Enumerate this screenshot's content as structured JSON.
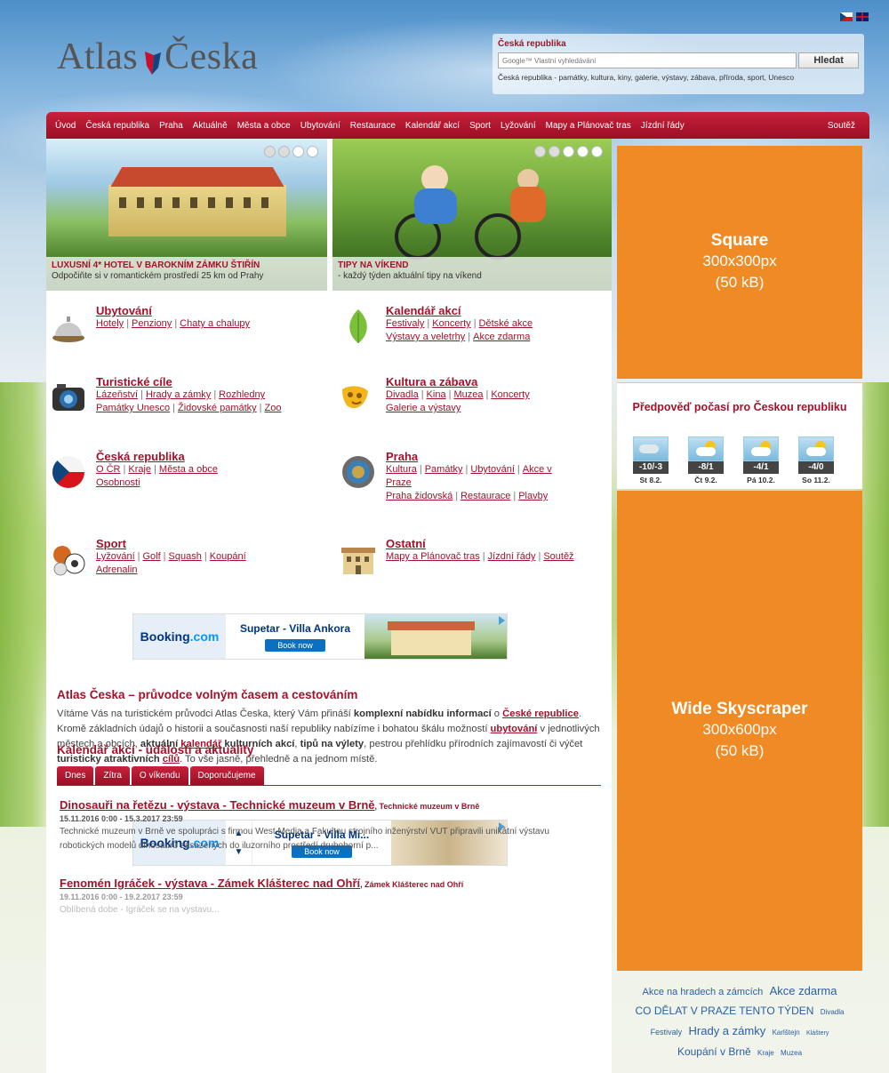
{
  "logo": {
    "text_left": "Atlas",
    "text_right": "Česka"
  },
  "search": {
    "title": "Česká republika",
    "placeholder": "Google™ Vlastní vyhledávání",
    "button": "Hledat",
    "description": "Česká republika - památky, kultura, kiny, galerie, výstavy, zábava, příroda, sport, Unesco"
  },
  "menu": {
    "items": [
      "Úvod",
      "Česká republika",
      "Praha",
      "Aktuálně",
      "Města a obce",
      "Ubytování",
      "Restaurace",
      "Kalendář akcí",
      "Sport",
      "Lyžování",
      "Mapy a Plánovač tras",
      "Jízdní řády"
    ],
    "contest": "Soutěž"
  },
  "slides": [
    {
      "title": "Luxusní 4* hotel v barokním zámku Štiřín",
      "subtitle": "Odpočiňte si v romantickém prostředí 25 km od Prahy"
    },
    {
      "title": "Tipy na víkend",
      "subtitle": "- každý týden aktuální tipy na víkend"
    }
  ],
  "categories": [
    {
      "title": "Ubytování",
      "lines": [
        [
          "Hotely",
          "Penziony",
          "Chaty a chalupy"
        ]
      ]
    },
    {
      "title": "Kalendář akcí",
      "lines": [
        [
          "Festivaly",
          "Koncerty",
          "Dětské akce"
        ],
        [
          "Výstavy a veletrhy",
          "Akce zdarma"
        ]
      ]
    },
    {
      "title": "Turistické cíle",
      "lines": [
        [
          "Lázeňství",
          "Hrady a zámky",
          "Rozhledny"
        ],
        [
          "Památky Unesco",
          "Židovské památky",
          "Zoo"
        ]
      ]
    },
    {
      "title": "Kultura a zábava",
      "lines": [
        [
          "Divadla",
          "Kina",
          "Muzea",
          "Koncerty"
        ],
        [
          "Galerie a výstavy"
        ]
      ]
    },
    {
      "title": "Česká republika",
      "lines": [
        [
          "O ČR",
          "Kraje",
          "Města a obce"
        ],
        [
          "Osobnosti"
        ]
      ]
    },
    {
      "title": "Praha",
      "lines": [
        [
          "Kultura",
          "Památky",
          "Ubytování",
          "Akce v"
        ],
        [
          "Praze"
        ],
        [
          "Praha židovská",
          "Restaurace",
          "Plavby"
        ]
      ]
    },
    {
      "title": "Sport",
      "lines": [
        [
          "Lyžování",
          "Golf",
          "Squash",
          "Koupání"
        ],
        [
          "Adrenalin"
        ]
      ]
    },
    {
      "title": "Ostatní",
      "lines": [
        [
          "Mapy a Plánovač tras",
          "Jízdní řády",
          "Soutěž"
        ]
      ]
    }
  ],
  "booking_ads": [
    {
      "logo_a": "Booking",
      "logo_b": ".com",
      "name": "Supetar - Villa Ankora",
      "button": "Book now"
    },
    {
      "logo_a": "Booking",
      "logo_b": ".com",
      "name": "Supetar - Villa Mi...",
      "button": "Book now",
      "up": "▲",
      "down": "▼"
    }
  ],
  "intro": {
    "title": "Atlas Česka – průvodce volným časem a cestováním",
    "p1": "Vítáme Vás na turistickém průvodci Atlas Česka, který Vám přináší ",
    "b1": "komplexní nabídku informací",
    "p2": " o ",
    "a1": "České republice",
    "p3": ". Kromě základních údajů o historii a současnosti naší republiky nabízíme i bohatou škálu možností ",
    "a2": "ubytování",
    "p4": " v jednotlivých městech a obcích, ",
    "b2": "aktuální",
    "a3": "kalendář",
    "b3": " kulturních akcí",
    "p5": ", ",
    "b4": "tipů na výlety",
    "p6": ", pestrou přehlídku přírodních zajímavostí či výčet ",
    "b5": "turisticky atraktivních",
    "a4": "cílů",
    "p7": ". To vše jasně, přehledně a na jednom místě."
  },
  "calendar": {
    "title": "Kalendář akcí - události a aktuality",
    "tabs": [
      "Dnes",
      "Zítra",
      "O víkendu",
      "Doporučujeme"
    ],
    "events": [
      {
        "title": "Dinosauři na řetězu - výstava - Technické muzeum v Brně",
        "venue": "Technické muzeum v Brně",
        "date": "15.11.2016 0:00 - 15.3.2017 23:59",
        "desc": "Technické muzeum v Brně ve spolupráci s firmou West Media a Fakultou strojního inženýrství VUT připravili unikátní výstavu robotických modelů dinosaurů zasazených do iluzorního prostředí druhohorní p..."
      },
      {
        "title": "Fenomén Igráček - výstava - Zámek Klášterec nad Ohří",
        "venue": "Zámek Klášterec nad Ohří",
        "date": "19.11.2016 0:00 - 19.2.2017 23:59",
        "desc": "Oblíbená dobe - Igráček se na vystavu..."
      }
    ]
  },
  "ads": {
    "square": {
      "name": "Square",
      "size": "300x300px",
      "weight": "(50 kB)"
    },
    "sky": {
      "name": "Wide Skyscraper",
      "size": "300x600px",
      "weight": "(50 kB)"
    }
  },
  "weather": {
    "title": "Předpověď počasí pro Českou republiku",
    "days": [
      {
        "temp": "-10/-3",
        "date": "St 8.2."
      },
      {
        "temp": "-8/1",
        "date": "Čt 9.2."
      },
      {
        "temp": "-4/1",
        "date": "Pá 10.2."
      },
      {
        "temp": "-4/0",
        "date": "So 11.2."
      }
    ]
  },
  "tags": [
    {
      "text": "Akce na hradech a zámcích",
      "size": 11
    },
    {
      "text": "Akce zdarma",
      "size": 13
    },
    {
      "text": "CO DĚLAT V PRAZE TENTO TÝDEN",
      "size": 12
    },
    {
      "text": "Divadla",
      "size": 8
    },
    {
      "text": "Festivaly",
      "size": 9
    },
    {
      "text": "Hrady a zámky",
      "size": 13
    },
    {
      "text": "Karlštejn",
      "size": 8
    },
    {
      "text": "Kláštery",
      "size": 7
    },
    {
      "text": "Koupání v Brně",
      "size": 12
    },
    {
      "text": "Kraje",
      "size": 8
    },
    {
      "text": "Muzea",
      "size": 8
    }
  ],
  "colors": {
    "accent": "#a3122b",
    "menu": "#b31a32",
    "ad": "#f08a24",
    "link_blue": "#2a5ea6"
  }
}
